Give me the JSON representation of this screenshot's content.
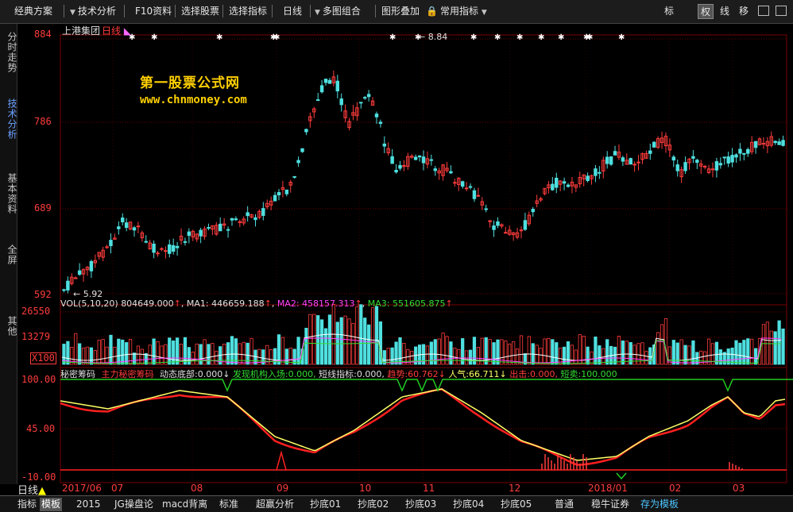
{
  "toolbar": {
    "plan": "经典方案",
    "analysis": "技术分析",
    "f10": "F10资料",
    "select_stock": "选择股票",
    "select_indicator": "选择指标",
    "period": "日线",
    "multi": "多图组合",
    "overlay": "图形叠加",
    "common": "常用指标",
    "right_buttons": [
      "标",
      "权",
      "线",
      "移"
    ]
  },
  "sidebar": {
    "tabs": [
      "分时走势",
      "技术分析",
      "基本资料",
      "全屏",
      "其他"
    ]
  },
  "main_chart": {
    "stock_name": "上港集团",
    "period": "日线",
    "y_labels": [
      "884",
      "786",
      "689",
      "592"
    ],
    "high_label": "8.84",
    "low_label": "5.92",
    "watermark_line1": "第一股票公式网",
    "watermark_line2": "www.chnmoney.com"
  },
  "volume": {
    "title": "VOL(5,10,20)",
    "value": "804649.000",
    "ma1_label": "MA1:",
    "ma1_value": "446659.188",
    "ma2_label": "MA2:",
    "ma2_value": "458157.313",
    "ma3_label": "MA3:",
    "ma3_value": "551605.875",
    "y_labels": [
      "26550",
      "13279"
    ],
    "unit": "X100"
  },
  "indicator": {
    "name": "秘密筹码",
    "items": [
      {
        "label": "主力秘密筹码",
        "value": ""
      },
      {
        "label": "动态底部:",
        "value": "0.000↓"
      },
      {
        "label": "发现机构入场:",
        "value": "0.000,"
      },
      {
        "label": "短线指标:",
        "value": "0.000,"
      },
      {
        "label": "趋势:",
        "value": "60.762↓"
      },
      {
        "label": "人气:",
        "value": "66.711↓"
      },
      {
        "label": "出击:",
        "value": "0.000,"
      },
      {
        "label": "短卖:",
        "value": "100.000"
      }
    ],
    "y_labels": [
      "100.00",
      "45.00",
      "-10.00"
    ]
  },
  "x_axis": {
    "labels": [
      "2017/06",
      "07",
      "08",
      "09",
      "10",
      "11",
      "12",
      "2018/01",
      "02",
      "03"
    ]
  },
  "period_indicator": "日线",
  "bottom_tabs": [
    "指标",
    "模板",
    "2015",
    "JG操盘论",
    "macd背离",
    "标准",
    "超赢分析",
    "抄底01",
    "抄底02",
    "抄底03",
    "抄底04",
    "抄底05",
    "普通",
    "稳牛证券",
    "存为模板"
  ],
  "colors": {
    "axis_red": "#ff3c3c",
    "up": "#ff3c3c",
    "down": "#4fe0e0",
    "yellow": "#ffd000",
    "grid": "#7a0000"
  }
}
